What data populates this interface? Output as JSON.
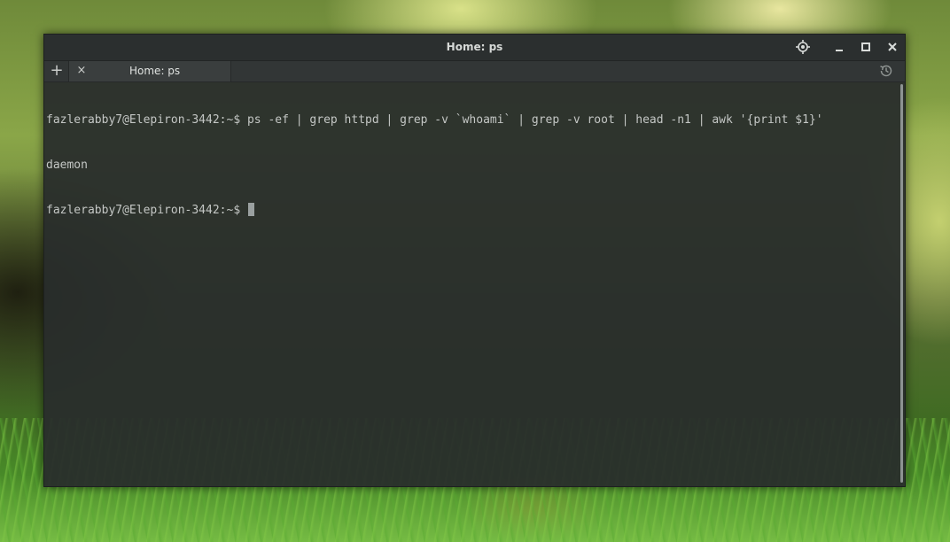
{
  "window": {
    "title": "Home: ps"
  },
  "tabbar": {
    "add_label": "+",
    "close_label": "×",
    "tab_label": "Home: ps"
  },
  "terminal": {
    "lines": [
      "fazlerabby7@Elepiron-3442:~$ ps -ef | grep httpd | grep -v `whoami` | grep -v root | head -n1 | awk '{print $1}'",
      "daemon",
      "fazlerabby7@Elepiron-3442:~$ "
    ]
  },
  "icons": {
    "pin": "locate-icon",
    "minimize": "minimize-icon",
    "maximize": "maximize-icon",
    "close": "close-icon",
    "history": "history-icon"
  },
  "colors": {
    "terminal_bg": "#2a2e2d",
    "terminal_fg": "#c4c7c5",
    "titlebar_bg": "#2b2f2f",
    "cursor": "#9aa0a0"
  }
}
